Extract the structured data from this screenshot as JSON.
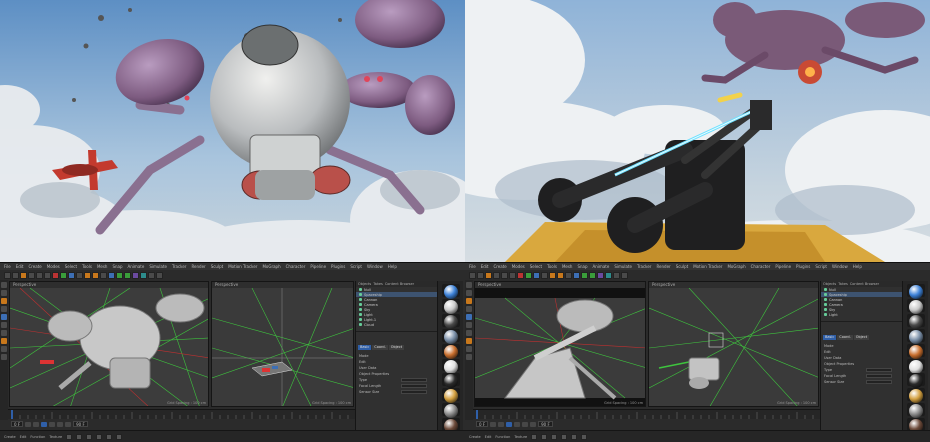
{
  "workspaces": [
    {
      "menus": [
        "File",
        "Edit",
        "Create",
        "Modes",
        "Select",
        "Tools",
        "Mesh",
        "Snap",
        "Animate",
        "Simulate",
        "Tracker",
        "Render",
        "Sculpt",
        "Motion Tracker",
        "MoGraph",
        "Character",
        "Pipeline",
        "Plugins",
        "Script",
        "Window",
        "Help"
      ],
      "viewports": [
        {
          "label": "Perspective",
          "footer": "Grid Spacing : 100 cm"
        },
        {
          "label": "Perspective",
          "footer": "Grid Spacing : 100 cm"
        }
      ],
      "objects": [
        "Null",
        "Spaceship",
        "Cannon",
        "Camera",
        "Sky",
        "Light",
        "Light.1",
        "Cloud"
      ],
      "panel_tabs": [
        "Objects",
        "Takes",
        "Content Browser"
      ],
      "attr_tabs": [
        "Basic",
        "Coord.",
        "Object"
      ],
      "attr_rows": [
        "Mode",
        "Edit",
        "User Data",
        "Object Properties",
        "Type",
        "Focal Length",
        "Sensor Size"
      ],
      "frame_start": "0 F",
      "frame_end": "90 F",
      "bottom": [
        "Create",
        "Edit",
        "Function",
        "Texture"
      ]
    },
    {
      "menus": [
        "File",
        "Edit",
        "Create",
        "Modes",
        "Select",
        "Tools",
        "Mesh",
        "Snap",
        "Animate",
        "Simulate",
        "Tracker",
        "Render",
        "Sculpt",
        "Motion Tracker",
        "MoGraph",
        "Character",
        "Pipeline",
        "Plugins",
        "Script",
        "Window",
        "Help"
      ],
      "viewports": [
        {
          "label": "Perspective",
          "footer": "Grid Spacing : 100 cm"
        },
        {
          "label": "Perspective",
          "footer": "Grid Spacing : 100 cm"
        }
      ],
      "objects": [
        "Null",
        "Spaceship",
        "Cannon",
        "Camera",
        "Sky",
        "Light"
      ],
      "panel_tabs": [
        "Objects",
        "Takes",
        "Content Browser"
      ],
      "attr_tabs": [
        "Basic",
        "Coord.",
        "Object"
      ],
      "attr_rows": [
        "Mode",
        "Edit",
        "User Data",
        "Object Properties",
        "Type",
        "Focal Length",
        "Sensor Size"
      ],
      "frame_start": "0 F",
      "frame_end": "90 F",
      "bottom": [
        "Create",
        "Edit",
        "Function",
        "Texture"
      ]
    }
  ],
  "colors": {
    "accent": "#2f5fa8",
    "orange": "#c8781c",
    "wire_green": "#3ec43e",
    "wire_red": "#c03030",
    "sky_top": "#6f9fd0",
    "cloud": "#e8ecef",
    "hull": "#d6d8d8",
    "purple": "#8c6a8c",
    "gold": "#e6b84a"
  },
  "materials": [
    "#3d82d8",
    "#c9c9c9",
    "#4a4a4a",
    "#7a8fa8",
    "#c96f2e",
    "#e0e0e0",
    "#2b2b2b",
    "#d3a040",
    "#8d8d8d",
    "#6c4a3a"
  ]
}
